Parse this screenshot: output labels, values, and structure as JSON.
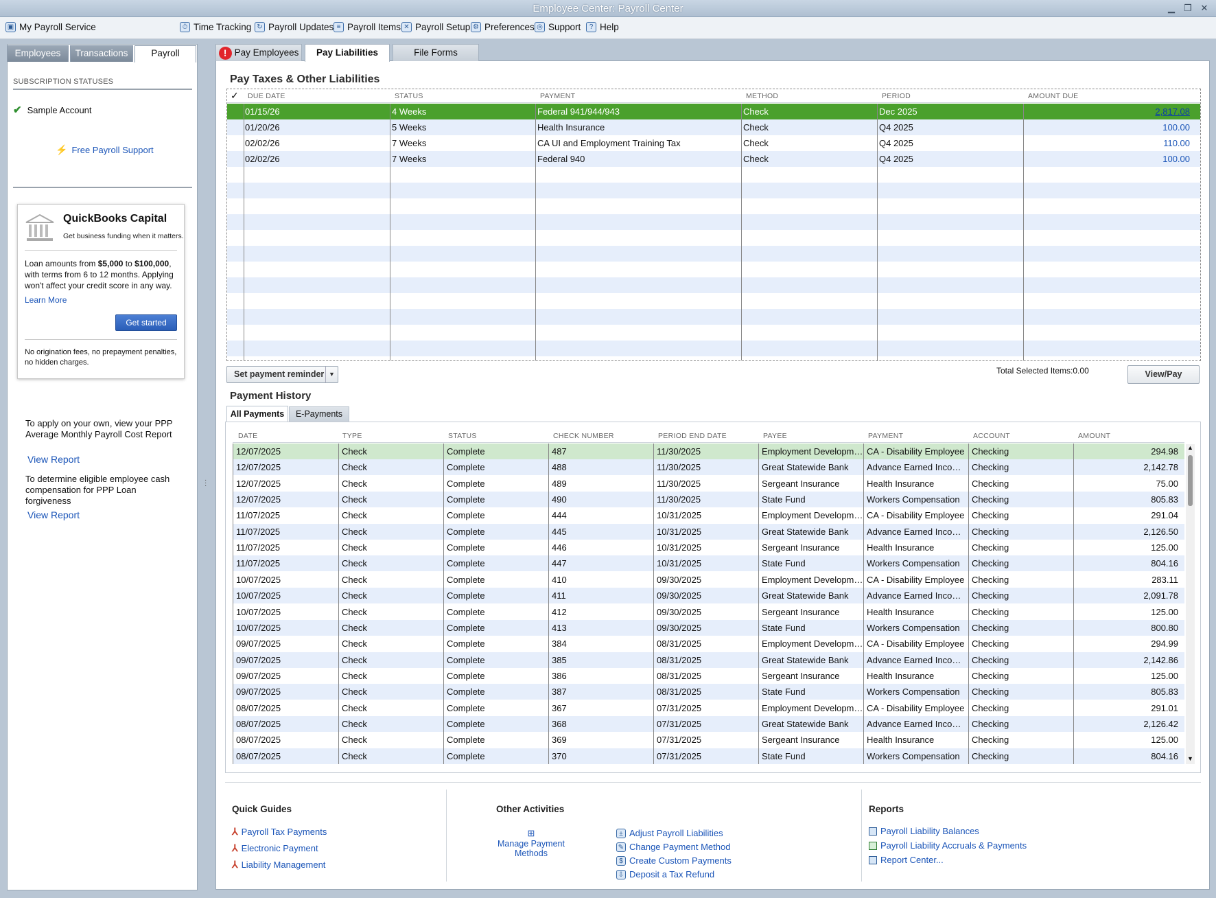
{
  "window": {
    "title": "Employee Center: Payroll Center"
  },
  "toolbar": {
    "my_payroll": "My Payroll Service",
    "time_tracking": "Time Tracking",
    "payroll_updates": "Payroll Updates",
    "payroll_items": "Payroll Items",
    "payroll_setup": "Payroll Setup",
    "preferences": "Preferences",
    "support": "Support",
    "help": "Help"
  },
  "left": {
    "tabs": [
      "Employees",
      "Transactions",
      "Payroll"
    ],
    "subscription_label": "SUBSCRIPTION STATUSES",
    "account": "Sample Account",
    "free_support": "Free Payroll Support",
    "capital": {
      "title": "QuickBooks Capital",
      "subtitle": "Get business funding when it matters.",
      "body_1": "Loan amounts from ",
      "amount_min": "$5,000",
      "body_2": " to ",
      "amount_max": "$100,000",
      "body_3": ", with terms from 6 to 12 months. Applying won't affect your credit score in any way.",
      "learn_more": "Learn More",
      "get_started": "Get started",
      "footer": "No origination fees, no prepayment penalties, no hidden charges."
    },
    "ppp1_text": "To apply on your own, view your PPP Average Monthly Payroll Cost Report",
    "ppp1_link": "View Report",
    "ppp2_text": "To determine eligible employee cash compensation for PPP Loan forgiveness",
    "ppp2_link": "View Report"
  },
  "main": {
    "tabs": [
      "Pay Employees",
      "Pay Liabilities",
      "File Forms"
    ],
    "liab_title": "Pay Taxes & Other Liabilities",
    "liab_headers": [
      "✓",
      "DUE DATE",
      "STATUS",
      "PAYMENT",
      "METHOD",
      "PERIOD",
      "AMOUNT DUE"
    ],
    "liab_rows": [
      {
        "due": "01/15/26",
        "status": "4 Weeks",
        "payment": "Federal 941/944/943",
        "method": "Check",
        "period": "Dec 2025",
        "amount": "2,817.08"
      },
      {
        "due": "01/20/26",
        "status": "5 Weeks",
        "payment": "Health Insurance",
        "method": "Check",
        "period": "Q4 2025",
        "amount": "100.00"
      },
      {
        "due": "02/02/26",
        "status": "7 Weeks",
        "payment": "CA UI and Employment Training Tax",
        "method": "Check",
        "period": "Q4 2025",
        "amount": "110.00"
      },
      {
        "due": "02/02/26",
        "status": "7 Weeks",
        "payment": "Federal 940",
        "method": "Check",
        "period": "Q4 2025",
        "amount": "100.00"
      }
    ],
    "reminder_btn": "Set payment reminder",
    "total_selected": "Total Selected Items:0.00",
    "view_pay": "View/Pay",
    "history_title": "Payment History",
    "history_tabs": [
      "All Payments",
      "E-Payments"
    ],
    "hist_headers": [
      "DATE",
      "TYPE",
      "STATUS",
      "CHECK NUMBER",
      "PERIOD END DATE",
      "PAYEE",
      "PAYMENT",
      "ACCOUNT",
      "AMOUNT"
    ],
    "hist_rows": [
      [
        "12/07/2025",
        "Check",
        "Complete",
        "487",
        "11/30/2025",
        "Employment Developmen...",
        "CA - Disability Employee",
        "Checking",
        "294.98"
      ],
      [
        "12/07/2025",
        "Check",
        "Complete",
        "488",
        "11/30/2025",
        "Great Statewide Bank",
        "Advance Earned Income ...",
        "Checking",
        "2,142.78"
      ],
      [
        "12/07/2025",
        "Check",
        "Complete",
        "489",
        "11/30/2025",
        "Sergeant Insurance",
        "Health Insurance",
        "Checking",
        "75.00"
      ],
      [
        "12/07/2025",
        "Check",
        "Complete",
        "490",
        "11/30/2025",
        "State Fund",
        "Workers Compensation",
        "Checking",
        "805.83"
      ],
      [
        "11/07/2025",
        "Check",
        "Complete",
        "444",
        "10/31/2025",
        "Employment Developmen...",
        "CA - Disability Employee",
        "Checking",
        "291.04"
      ],
      [
        "11/07/2025",
        "Check",
        "Complete",
        "445",
        "10/31/2025",
        "Great Statewide Bank",
        "Advance Earned Income ...",
        "Checking",
        "2,126.50"
      ],
      [
        "11/07/2025",
        "Check",
        "Complete",
        "446",
        "10/31/2025",
        "Sergeant Insurance",
        "Health Insurance",
        "Checking",
        "125.00"
      ],
      [
        "11/07/2025",
        "Check",
        "Complete",
        "447",
        "10/31/2025",
        "State Fund",
        "Workers Compensation",
        "Checking",
        "804.16"
      ],
      [
        "10/07/2025",
        "Check",
        "Complete",
        "410",
        "09/30/2025",
        "Employment Developmen...",
        "CA - Disability Employee",
        "Checking",
        "283.11"
      ],
      [
        "10/07/2025",
        "Check",
        "Complete",
        "411",
        "09/30/2025",
        "Great Statewide Bank",
        "Advance Earned Income ...",
        "Checking",
        "2,091.78"
      ],
      [
        "10/07/2025",
        "Check",
        "Complete",
        "412",
        "09/30/2025",
        "Sergeant Insurance",
        "Health Insurance",
        "Checking",
        "125.00"
      ],
      [
        "10/07/2025",
        "Check",
        "Complete",
        "413",
        "09/30/2025",
        "State Fund",
        "Workers Compensation",
        "Checking",
        "800.80"
      ],
      [
        "09/07/2025",
        "Check",
        "Complete",
        "384",
        "08/31/2025",
        "Employment Developmen...",
        "CA - Disability Employee",
        "Checking",
        "294.99"
      ],
      [
        "09/07/2025",
        "Check",
        "Complete",
        "385",
        "08/31/2025",
        "Great Statewide Bank",
        "Advance Earned Income ...",
        "Checking",
        "2,142.86"
      ],
      [
        "09/07/2025",
        "Check",
        "Complete",
        "386",
        "08/31/2025",
        "Sergeant Insurance",
        "Health Insurance",
        "Checking",
        "125.00"
      ],
      [
        "09/07/2025",
        "Check",
        "Complete",
        "387",
        "08/31/2025",
        "State Fund",
        "Workers Compensation",
        "Checking",
        "805.83"
      ],
      [
        "08/07/2025",
        "Check",
        "Complete",
        "367",
        "07/31/2025",
        "Employment Developmen...",
        "CA - Disability Employee",
        "Checking",
        "291.01"
      ],
      [
        "08/07/2025",
        "Check",
        "Complete",
        "368",
        "07/31/2025",
        "Great Statewide Bank",
        "Advance Earned Income ...",
        "Checking",
        "2,126.42"
      ],
      [
        "08/07/2025",
        "Check",
        "Complete",
        "369",
        "07/31/2025",
        "Sergeant Insurance",
        "Health Insurance",
        "Checking",
        "125.00"
      ],
      [
        "08/07/2025",
        "Check",
        "Complete",
        "370",
        "07/31/2025",
        "State Fund",
        "Workers Compensation",
        "Checking",
        "804.16"
      ]
    ],
    "quick_guides": {
      "title": "Quick Guides",
      "items": [
        "Payroll Tax Payments",
        "Electronic Payment",
        "Liability Management"
      ]
    },
    "other_activities": {
      "title": "Other Activities",
      "manage": "Manage Payment Methods",
      "items": [
        "Adjust Payroll Liabilities",
        "Change Payment Method",
        "Create Custom Payments",
        "Deposit a Tax Refund"
      ]
    },
    "reports": {
      "title": "Reports",
      "items": [
        "Payroll Liability Balances",
        "Payroll Liability Accruals & Payments",
        "Report Center..."
      ]
    }
  }
}
